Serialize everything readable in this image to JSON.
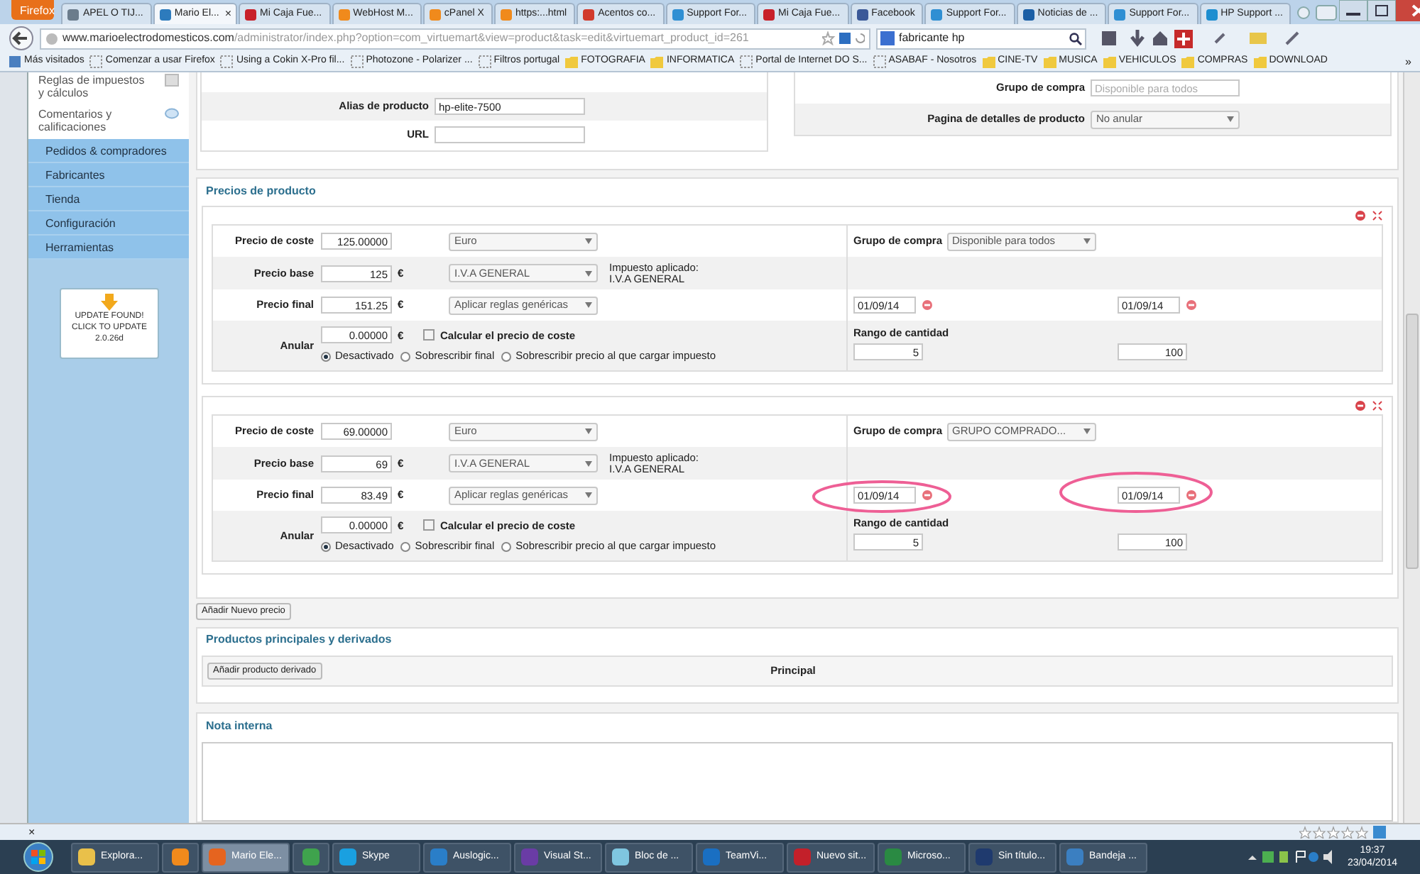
{
  "browser": {
    "menu_button": "Firefox",
    "tabs": [
      {
        "label": "APEL O TIJ...",
        "kind": "arrow",
        "selected": false
      },
      {
        "label": "Mario El...",
        "kind": "joomla",
        "selected": true,
        "close": "×"
      },
      {
        "label": "Mi Caja Fue...",
        "kind": "red",
        "selected": false
      },
      {
        "label": "WebHost M...",
        "kind": "cpanel",
        "selected": false
      },
      {
        "label": "cPanel X",
        "kind": "cpanel",
        "selected": false
      },
      {
        "label": "https:...html",
        "kind": "cpanel",
        "selected": false
      },
      {
        "label": "Acentos co...",
        "kind": "wiki",
        "selected": false
      },
      {
        "label": "Support For...",
        "kind": "globe",
        "selected": false
      },
      {
        "label": "Mi Caja Fue...",
        "kind": "red",
        "selected": false
      },
      {
        "label": "Facebook",
        "kind": "facebook",
        "selected": false
      },
      {
        "label": "Support For...",
        "kind": "globe",
        "selected": false
      },
      {
        "label": "Noticias de ...",
        "kind": "news",
        "selected": false
      },
      {
        "label": "Support For...",
        "kind": "globe",
        "selected": false
      },
      {
        "label": "HP Support ...",
        "kind": "hp",
        "selected": false
      }
    ],
    "url_host": "www.marioelectrodomesticos.com",
    "url_path": "/administrator/index.php?option=com_virtuemart&view=product&task=edit&virtuemart_product_id=261",
    "search": "fabricante hp",
    "bookmarks": [
      {
        "label": "Más visitados",
        "kind": "special"
      },
      {
        "label": "Comenzar a usar Firefox",
        "kind": "page"
      },
      {
        "label": "Using a Cokin X-Pro fil...",
        "kind": "page"
      },
      {
        "label": "Photozone - Polarizer ...",
        "kind": "page"
      },
      {
        "label": "Filtros portugal",
        "kind": "page"
      },
      {
        "label": "FOTOGRAFIA",
        "kind": "folder"
      },
      {
        "label": "INFORMATICA",
        "kind": "folder"
      },
      {
        "label": "Portal de Internet DO S...",
        "kind": "page"
      },
      {
        "label": "ASABAF - Nosotros",
        "kind": "page"
      },
      {
        "label": "CINE-TV",
        "kind": "folder"
      },
      {
        "label": "MUSICA",
        "kind": "folder"
      },
      {
        "label": "VEHICULOS",
        "kind": "folder"
      },
      {
        "label": "COMPRAS",
        "kind": "folder"
      },
      {
        "label": "DOWNLOAD",
        "kind": "folder"
      }
    ],
    "more": "»"
  },
  "sidebar": {
    "items": [
      {
        "label": "Reglas de impuestos y cálculos",
        "kind": "link"
      },
      {
        "label": "Comentarios y calificaciones",
        "kind": "link"
      },
      {
        "label": "Pedidos & compradores",
        "kind": "section"
      },
      {
        "label": "Fabricantes",
        "kind": "section"
      },
      {
        "label": "Tienda",
        "kind": "section"
      },
      {
        "label": "Configuración",
        "kind": "section"
      },
      {
        "label": "Herramientas",
        "kind": "section"
      }
    ],
    "update_notice": [
      "UPDATE FOUND!",
      "CLICK TO UPDATE",
      "2.0.26d"
    ]
  },
  "product": {
    "left": [
      {
        "label": "Alias de producto",
        "value": "hp-elite-7500"
      },
      {
        "label": "URL"
      }
    ],
    "right": [
      {
        "label": "Grupo de compra",
        "placeholder": "Disponible para todos"
      },
      {
        "label": "Pagina de detalles de producto",
        "value": "No anular"
      }
    ]
  },
  "prices": {
    "title": "Precios de producto",
    "entries": [
      {
        "labels": [
          "Precio de coste",
          "Precio base",
          "Precio final",
          "Anular"
        ],
        "cost": "125.00000",
        "currency": "Euro",
        "base": "125",
        "symbols": [
          "€",
          "€",
          "€"
        ],
        "tax": "I.V.A GENERAL",
        "tax_applied": [
          "Impuesto aplicado:",
          "I.V.A GENERAL"
        ],
        "final": "151.25",
        "rule": "Aplicar reglas genéricas",
        "override": "0.00000",
        "calc_label": "Calcular el precio de coste",
        "calc_checked": false,
        "radios": [
          {
            "label": "Desactivado",
            "selected": true
          },
          {
            "label": "Sobrescribir final",
            "selected": false
          },
          {
            "label": "Sobrescribir precio al que cargar impuesto",
            "selected": false
          }
        ],
        "group_label": "Grupo de compra",
        "group": "Disponible para todos",
        "date_from": "01/09/14",
        "date_to": "01/09/14",
        "range_label": "Rango de cantidad",
        "qty_from": "5",
        "qty_to": "100",
        "dates_circled": false
      },
      {
        "labels": [
          "Precio de coste",
          "Precio base",
          "Precio final",
          "Anular"
        ],
        "cost": "69.00000",
        "currency": "Euro",
        "base": "69",
        "symbols": [
          "€",
          "€",
          "€"
        ],
        "tax": "I.V.A GENERAL",
        "tax_applied": [
          "Impuesto aplicado:",
          "I.V.A GENERAL"
        ],
        "final": "83.49",
        "rule": "Aplicar reglas genéricas",
        "override": "0.00000",
        "calc_label": "Calcular el precio de coste",
        "calc_checked": false,
        "radios": [
          {
            "label": "Desactivado",
            "selected": true
          },
          {
            "label": "Sobrescribir final",
            "selected": false
          },
          {
            "label": "Sobrescribir precio al que cargar impuesto",
            "selected": false
          }
        ],
        "group_label": "Grupo de compra",
        "group": "GRUPO COMPRADO...",
        "date_from": "01/09/14",
        "date_to": "01/09/14",
        "range_label": "Rango de cantidad",
        "qty_from": "5",
        "qty_to": "100",
        "dates_circled": true
      }
    ],
    "add_button": "Añadir Nuevo precio"
  },
  "derived": {
    "title": "Productos principales y derivados",
    "button": "Añadir producto derivado",
    "column": "Principal"
  },
  "notes": {
    "title": "Nota interna"
  },
  "addon_bar": {
    "close": "×"
  },
  "taskbar": {
    "items": [
      {
        "label": "Explora...",
        "kind": "explorer",
        "selected": false
      },
      {
        "kind": "media",
        "selected": false
      },
      {
        "label": "Mario Ele...",
        "kind": "firefox",
        "selected": true
      },
      {
        "kind": "chrome",
        "selected": false
      },
      {
        "label": "Skype",
        "kind": "skype",
        "selected": false
      },
      {
        "label": "Auslogic...",
        "kind": "globe",
        "selected": false
      },
      {
        "label": "Visual St...",
        "kind": "studio",
        "selected": false
      },
      {
        "label": "Bloc de ...",
        "kind": "notepad",
        "selected": false
      },
      {
        "label": "TeamVi...",
        "kind": "teamviewer",
        "selected": false
      },
      {
        "label": "Nuevo sit...",
        "kind": "filezilla",
        "selected": false
      },
      {
        "label": "Microso...",
        "kind": "excel",
        "selected": false
      },
      {
        "label": "Sin título...",
        "kind": "photoshop",
        "selected": false
      },
      {
        "label": "Bandeja ...",
        "kind": "mail",
        "selected": false
      }
    ],
    "time": "19:37",
    "date": "23/04/2014"
  }
}
